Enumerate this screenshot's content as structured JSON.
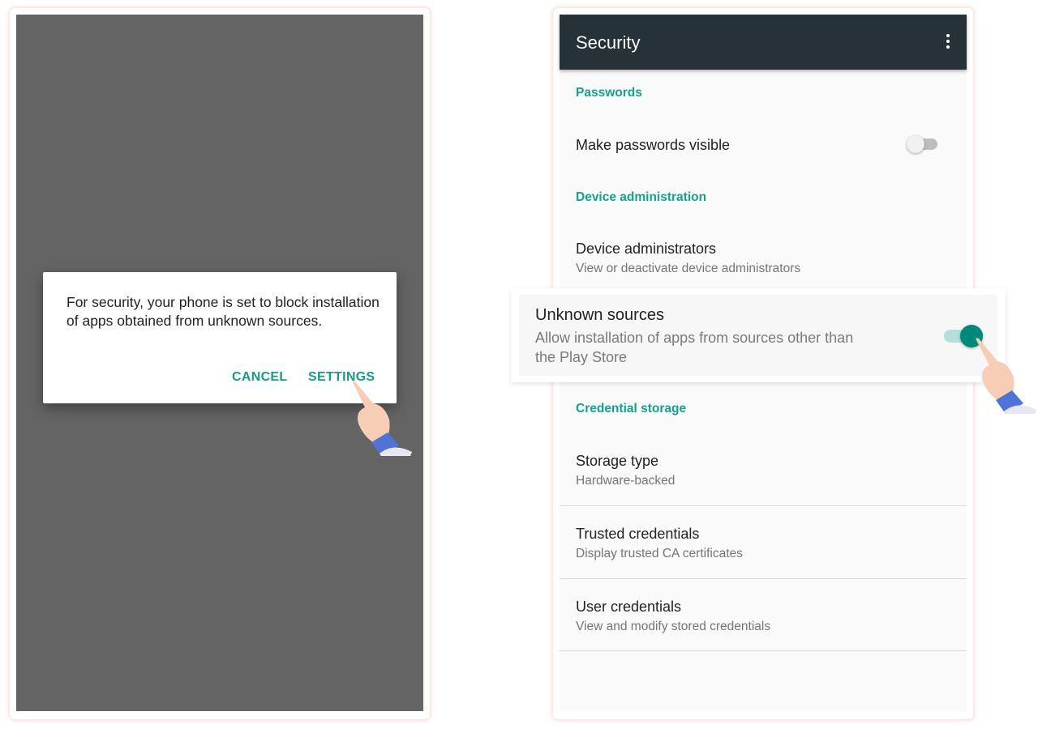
{
  "left_screen": {
    "dialog": {
      "message": "For security, your phone is set to block installation of apps obtained from unknown sources.",
      "cancel_label": "CANCEL",
      "settings_label": "SETTINGS"
    }
  },
  "right_screen": {
    "title": "Security",
    "menu_icon": "more-vert-icon",
    "sections": {
      "passwords": "Passwords",
      "device_admin": "Device administration",
      "credential_storage": "Credential storage"
    },
    "items": {
      "make_passwords_visible": {
        "title": "Make passwords visible",
        "enabled": false
      },
      "device_administrators": {
        "title": "Device administrators",
        "subtitle": "View or deactivate device administrators"
      },
      "unknown_sources": {
        "title": "Unknown sources",
        "subtitle_line1": "Allow installation of apps from sources other than",
        "subtitle_line2": "the Play Store",
        "enabled": true
      },
      "storage_type": {
        "title": "Storage type",
        "subtitle": "Hardware-backed"
      },
      "trusted_credentials": {
        "title": "Trusted credentials",
        "subtitle": "Display trusted CA certificates"
      },
      "user_credentials": {
        "title": "User credentials",
        "subtitle": "View and modify stored credentials"
      }
    }
  },
  "colors": {
    "accent": "#009688",
    "appbar": "#263238",
    "scrim": "#646464"
  }
}
